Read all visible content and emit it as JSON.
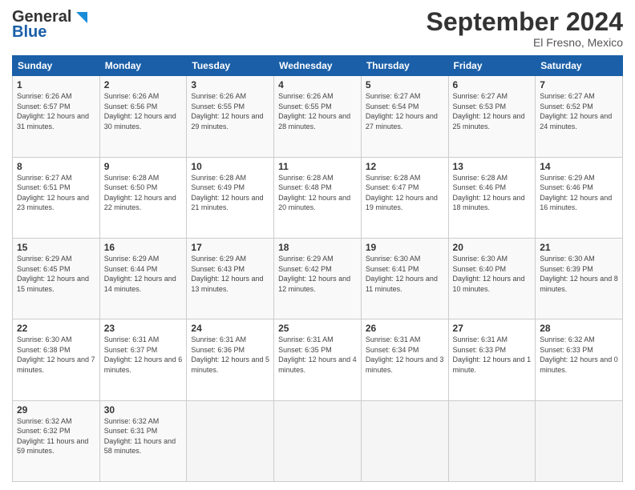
{
  "header": {
    "logo": {
      "line1": "General",
      "line2": "Blue"
    },
    "title": "September 2024",
    "location": "El Fresno, Mexico"
  },
  "days": [
    "Sunday",
    "Monday",
    "Tuesday",
    "Wednesday",
    "Thursday",
    "Friday",
    "Saturday"
  ],
  "weeks": [
    [
      {
        "num": "1",
        "sunrise": "6:26 AM",
        "sunset": "6:57 PM",
        "daylight": "12 hours and 31 minutes."
      },
      {
        "num": "2",
        "sunrise": "6:26 AM",
        "sunset": "6:56 PM",
        "daylight": "12 hours and 30 minutes."
      },
      {
        "num": "3",
        "sunrise": "6:26 AM",
        "sunset": "6:55 PM",
        "daylight": "12 hours and 29 minutes."
      },
      {
        "num": "4",
        "sunrise": "6:26 AM",
        "sunset": "6:55 PM",
        "daylight": "12 hours and 28 minutes."
      },
      {
        "num": "5",
        "sunrise": "6:27 AM",
        "sunset": "6:54 PM",
        "daylight": "12 hours and 27 minutes."
      },
      {
        "num": "6",
        "sunrise": "6:27 AM",
        "sunset": "6:53 PM",
        "daylight": "12 hours and 25 minutes."
      },
      {
        "num": "7",
        "sunrise": "6:27 AM",
        "sunset": "6:52 PM",
        "daylight": "12 hours and 24 minutes."
      }
    ],
    [
      {
        "num": "8",
        "sunrise": "6:27 AM",
        "sunset": "6:51 PM",
        "daylight": "12 hours and 23 minutes."
      },
      {
        "num": "9",
        "sunrise": "6:28 AM",
        "sunset": "6:50 PM",
        "daylight": "12 hours and 22 minutes."
      },
      {
        "num": "10",
        "sunrise": "6:28 AM",
        "sunset": "6:49 PM",
        "daylight": "12 hours and 21 minutes."
      },
      {
        "num": "11",
        "sunrise": "6:28 AM",
        "sunset": "6:48 PM",
        "daylight": "12 hours and 20 minutes."
      },
      {
        "num": "12",
        "sunrise": "6:28 AM",
        "sunset": "6:47 PM",
        "daylight": "12 hours and 19 minutes."
      },
      {
        "num": "13",
        "sunrise": "6:28 AM",
        "sunset": "6:46 PM",
        "daylight": "12 hours and 18 minutes."
      },
      {
        "num": "14",
        "sunrise": "6:29 AM",
        "sunset": "6:46 PM",
        "daylight": "12 hours and 16 minutes."
      }
    ],
    [
      {
        "num": "15",
        "sunrise": "6:29 AM",
        "sunset": "6:45 PM",
        "daylight": "12 hours and 15 minutes."
      },
      {
        "num": "16",
        "sunrise": "6:29 AM",
        "sunset": "6:44 PM",
        "daylight": "12 hours and 14 minutes."
      },
      {
        "num": "17",
        "sunrise": "6:29 AM",
        "sunset": "6:43 PM",
        "daylight": "12 hours and 13 minutes."
      },
      {
        "num": "18",
        "sunrise": "6:29 AM",
        "sunset": "6:42 PM",
        "daylight": "12 hours and 12 minutes."
      },
      {
        "num": "19",
        "sunrise": "6:30 AM",
        "sunset": "6:41 PM",
        "daylight": "12 hours and 11 minutes."
      },
      {
        "num": "20",
        "sunrise": "6:30 AM",
        "sunset": "6:40 PM",
        "daylight": "12 hours and 10 minutes."
      },
      {
        "num": "21",
        "sunrise": "6:30 AM",
        "sunset": "6:39 PM",
        "daylight": "12 hours and 8 minutes."
      }
    ],
    [
      {
        "num": "22",
        "sunrise": "6:30 AM",
        "sunset": "6:38 PM",
        "daylight": "12 hours and 7 minutes."
      },
      {
        "num": "23",
        "sunrise": "6:31 AM",
        "sunset": "6:37 PM",
        "daylight": "12 hours and 6 minutes."
      },
      {
        "num": "24",
        "sunrise": "6:31 AM",
        "sunset": "6:36 PM",
        "daylight": "12 hours and 5 minutes."
      },
      {
        "num": "25",
        "sunrise": "6:31 AM",
        "sunset": "6:35 PM",
        "daylight": "12 hours and 4 minutes."
      },
      {
        "num": "26",
        "sunrise": "6:31 AM",
        "sunset": "6:34 PM",
        "daylight": "12 hours and 3 minutes."
      },
      {
        "num": "27",
        "sunrise": "6:31 AM",
        "sunset": "6:33 PM",
        "daylight": "12 hours and 1 minute."
      },
      {
        "num": "28",
        "sunrise": "6:32 AM",
        "sunset": "6:33 PM",
        "daylight": "12 hours and 0 minutes."
      }
    ],
    [
      {
        "num": "29",
        "sunrise": "6:32 AM",
        "sunset": "6:32 PM",
        "daylight": "11 hours and 59 minutes."
      },
      {
        "num": "30",
        "sunrise": "6:32 AM",
        "sunset": "6:31 PM",
        "daylight": "11 hours and 58 minutes."
      },
      null,
      null,
      null,
      null,
      null
    ]
  ]
}
